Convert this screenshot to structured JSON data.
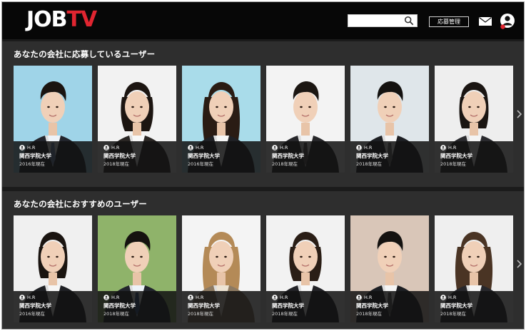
{
  "brand": {
    "part1": "JOB",
    "part2": "TV"
  },
  "header": {
    "manage_label": "応募管理",
    "search_placeholder": ""
  },
  "colors": {
    "accent": "#e02530",
    "background": "#1b1b1b",
    "section": "#2e2e2e"
  },
  "sections": [
    {
      "title": "あなたの会社に応募しているユーザー",
      "cards": [
        {
          "initials": "H.R",
          "university": "関西学院大学",
          "year": "2016年現在",
          "bg": "#9fd4e8",
          "hair": "#1a1410",
          "suit": "#22252c",
          "shirt": "#eef3f8",
          "tie": "#6f8fb8",
          "hair_style": "short"
        },
        {
          "initials": "H.R",
          "university": "関西学院大学",
          "year": "2018年現在",
          "bg": "#f2f2f2",
          "hair": "#1c1511",
          "suit": "#2a2624",
          "shirt": "#f7f7f7",
          "tie": "",
          "hair_style": "bob"
        },
        {
          "initials": "H.R",
          "university": "関西学院大学",
          "year": "2016年現在",
          "bg": "#a9dcea",
          "hair": "#2a1c14",
          "suit": "#1f2024",
          "shirt": "#f6f6f6",
          "tie": "",
          "hair_style": "long"
        },
        {
          "initials": "H.R",
          "university": "関西学院大学",
          "year": "2018年現在",
          "bg": "#f3f3f3",
          "hair": "#1b1612",
          "suit": "#262629",
          "shirt": "#f2f2f2",
          "tie": "#55504d",
          "hair_style": "short"
        },
        {
          "initials": "H.R",
          "university": "関西学院大学",
          "year": "2018年現在",
          "bg": "#dfe6ea",
          "hair": "#141210",
          "suit": "#1d1f23",
          "shirt": "#f4f4f4",
          "tie": "#6a6a6a",
          "hair_style": "short"
        },
        {
          "initials": "H.R",
          "university": "関西学院大学",
          "year": "2018年現在",
          "bg": "#eeeeee",
          "hair": "#1a1512",
          "suit": "#2a2a2e",
          "shirt": "#f4f4f4",
          "tie": "",
          "hair_style": "ponytail"
        }
      ]
    },
    {
      "title": "あなたの会社におすすめのユーザー",
      "cards": [
        {
          "initials": "H.R",
          "university": "関西学院大学",
          "year": "2016年現在",
          "bg": "#f0f0f0",
          "hair": "#1a1410",
          "suit": "#1f2024",
          "shirt": "#f6f6f6",
          "tie": "",
          "hair_style": "ponytail"
        },
        {
          "initials": "H.R",
          "university": "関西学院大学",
          "year": "2018年現在",
          "bg": "#8fb36a",
          "hair": "#15120f",
          "suit": "#22252c",
          "shirt": "#eef3f8",
          "tie": "#2e4f88",
          "hair_style": "short"
        },
        {
          "initials": "H.R",
          "university": "関西学院大学",
          "year": "2018年現在",
          "bg": "#f4f4f4",
          "hair": "#b48a57",
          "suit": "#8d7a62",
          "shirt": "#ede3d3",
          "tie": "",
          "hair_style": "long"
        },
        {
          "initials": "H.R",
          "university": "関西学院大学",
          "year": "2018年現在",
          "bg": "#f2f2f2",
          "hair": "#2a1e16",
          "suit": "#222226",
          "shirt": "#f7f7f7",
          "tie": "",
          "hair_style": "bob"
        },
        {
          "initials": "H.R",
          "university": "関西学院大学",
          "year": "2018年現在",
          "bg": "#d9c6b8",
          "hair": "#141210",
          "suit": "#1d1f23",
          "shirt": "#f4f4f4",
          "tie": "#5a5a5a",
          "hair_style": "short"
        },
        {
          "initials": "H.R",
          "university": "関西学院大学",
          "year": "2018年現在",
          "bg": "#efefef",
          "hair": "#4a3424",
          "suit": "#27272b",
          "shirt": "#f4f4f4",
          "tie": "",
          "hair_style": "long"
        }
      ]
    }
  ]
}
